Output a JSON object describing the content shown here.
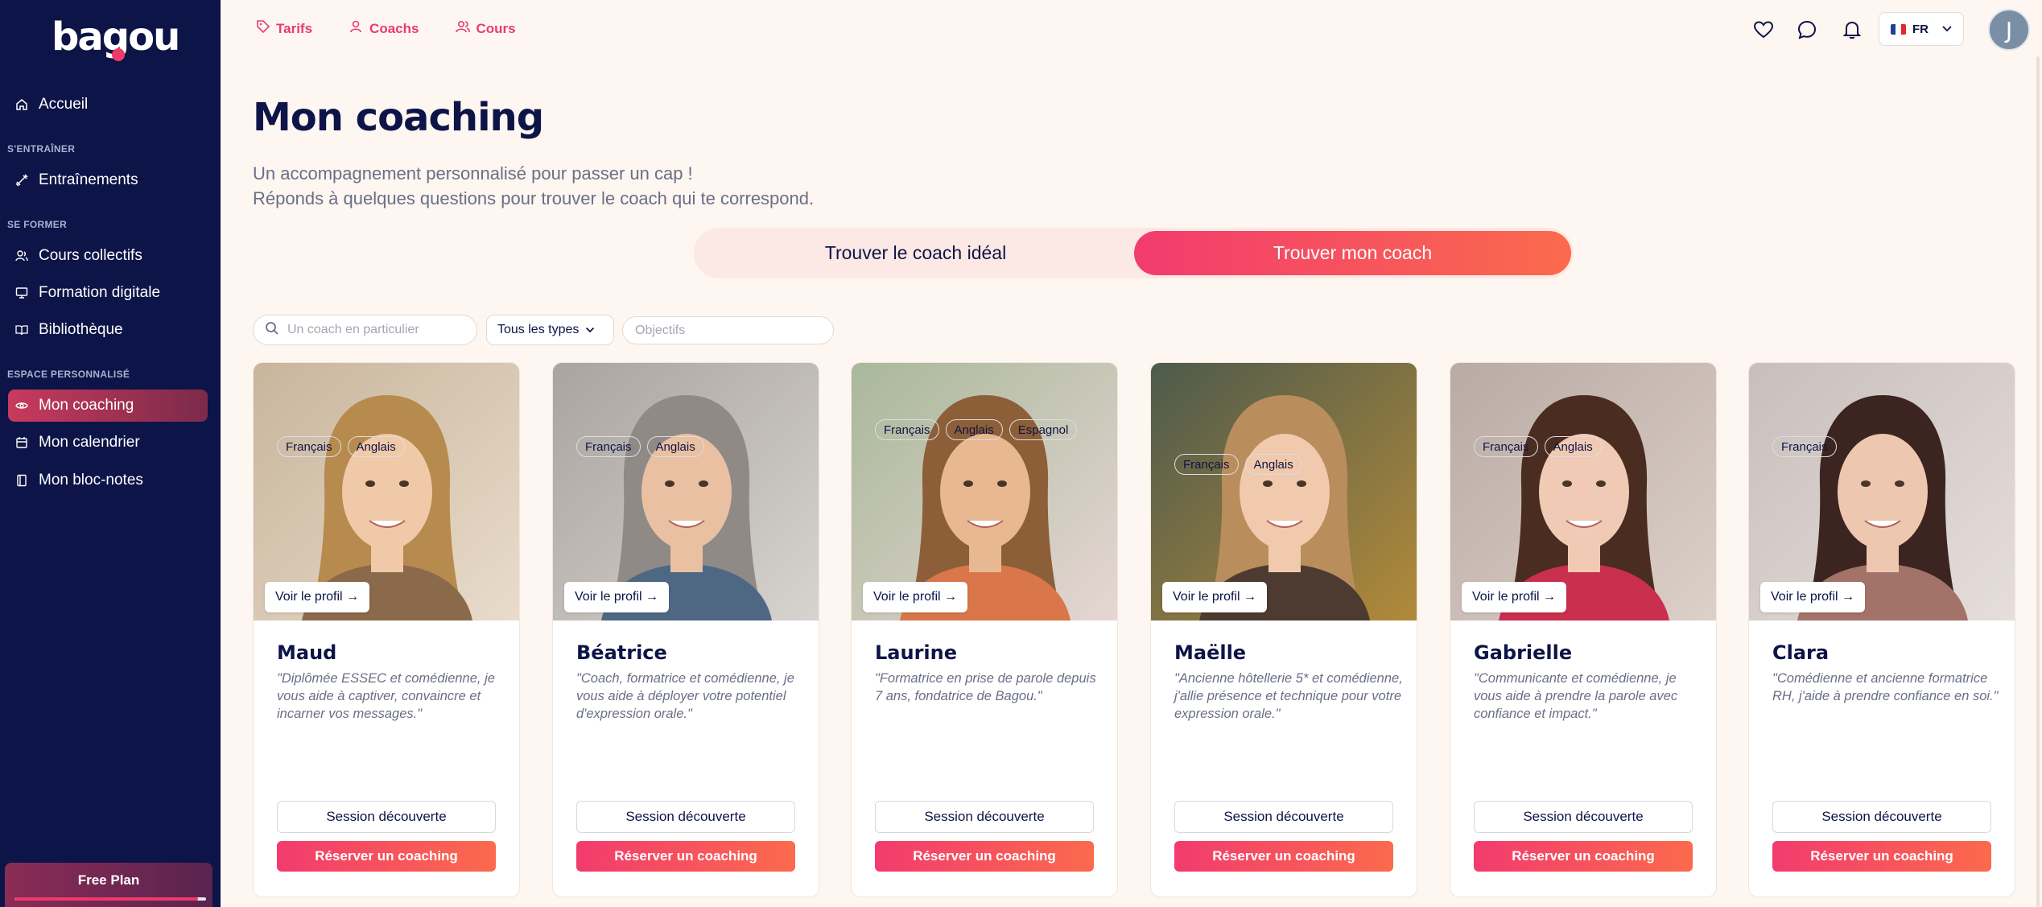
{
  "app": {
    "logo": "bagou"
  },
  "sidebar": {
    "home": "Accueil",
    "sections": [
      {
        "label": "S'ENTRAÎNER",
        "items": [
          "Entraînements"
        ]
      },
      {
        "label": "SE FORMER",
        "items": [
          "Cours collectifs",
          "Formation digitale",
          "Bibliothèque"
        ]
      },
      {
        "label": "ESPACE PERSONNALISÉ",
        "items": [
          "Mon coaching",
          "Mon calendrier",
          "Mon bloc-notes"
        ]
      }
    ],
    "active": "Mon coaching",
    "plan": {
      "label": "Free Plan",
      "progress": 0.96
    }
  },
  "topnav": {
    "tarifs": "Tarifs",
    "coachs": "Coachs",
    "cours": "Cours"
  },
  "top_icons": [
    "heart-icon",
    "chat-icon",
    "bell-icon"
  ],
  "language": {
    "code": "FR"
  },
  "user": {
    "initial": "J"
  },
  "page": {
    "title": "Mon coaching",
    "subtitle_1": "Un accompagnement personnalisé pour passer un cap !",
    "subtitle_2": "Réponds à quelques questions pour trouver le coach qui te correspond.",
    "toggle": {
      "option_1": "Trouver le coach idéal",
      "option_2": "Trouver mon coach",
      "selected": "Trouver mon coach"
    }
  },
  "filters": {
    "search_placeholder": "Un coach en particulier",
    "type_select": "Tous les types",
    "objectives_placeholder": "Objectifs"
  },
  "card_labels": {
    "profile": "Voir le profil →",
    "discovery": "Session découverte",
    "book": "Réserver un coaching"
  },
  "coaches": [
    {
      "name": "Maud",
      "quote": "\"Diplômée ESSEC et comédienne, je vous aide à captiver, convaincre et incarner vos messages.\"",
      "languages": [
        "Français",
        "Anglais"
      ]
    },
    {
      "name": "Béatrice",
      "quote": "\"Coach, formatrice et comédienne, je vous aide à déployer votre potentiel d'expression orale.\"",
      "languages": [
        "Français",
        "Anglais"
      ]
    },
    {
      "name": "Laurine",
      "quote": "\"Formatrice en prise de parole depuis 7 ans, fondatrice de Bagou.\"",
      "languages": [
        "Français",
        "Anglais",
        "Espagnol"
      ]
    },
    {
      "name": "Maëlle",
      "quote": "\"Ancienne hôtellerie 5* et comédienne, j'allie présence et technique pour votre expression orale.\"",
      "languages": [
        "Français",
        "Anglais"
      ]
    },
    {
      "name": "Gabrielle",
      "quote": "\"Communicante et comédienne, je vous aide à prendre la parole avec confiance et impact.\"",
      "languages": [
        "Français",
        "Anglais"
      ]
    },
    {
      "name": "Clara",
      "quote": "\"Comédienne et ancienne formatrice RH, j'aide à prendre confiance en soi.\"",
      "languages": [
        "Français"
      ]
    }
  ],
  "colors": {
    "sidebar": "#0d1447",
    "accent": "#f23b6e",
    "accent_2": "#fb6a4d",
    "background": "#fdf6f1"
  }
}
